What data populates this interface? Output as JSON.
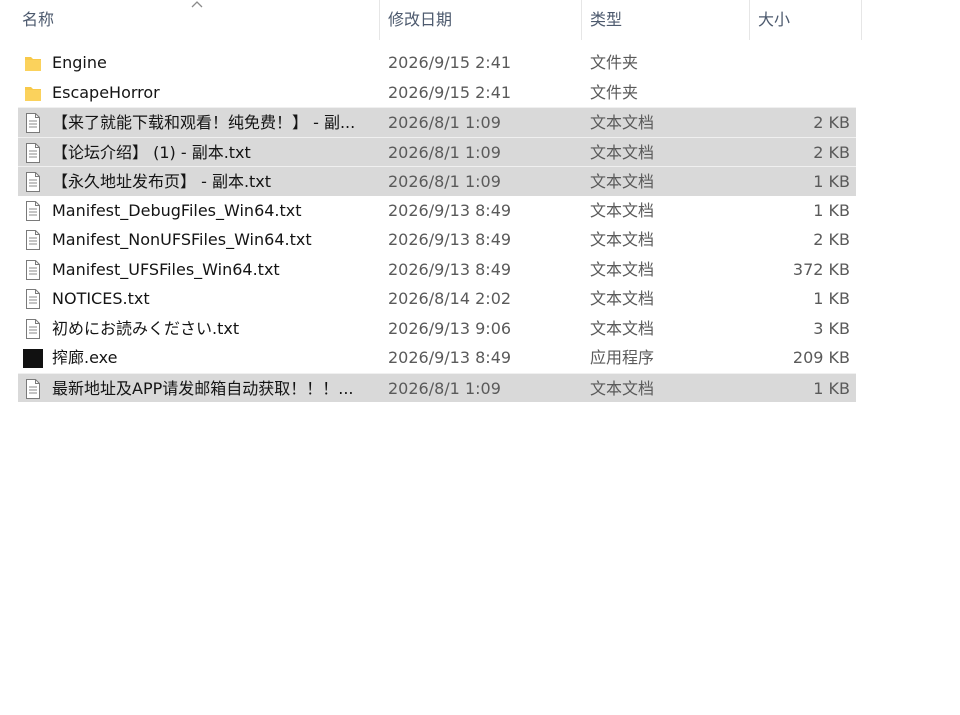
{
  "header": {
    "name": "名称",
    "date": "修改日期",
    "type": "类型",
    "size": "大小"
  },
  "files": [
    {
      "name": "Engine",
      "date": "2026/9/15 2:41",
      "type": "文件夹",
      "size": "",
      "icon": "folder-icon",
      "selected": false
    },
    {
      "name": "EscapeHorror",
      "date": "2026/9/15 2:41",
      "type": "文件夹",
      "size": "",
      "icon": "folder-icon",
      "selected": false
    },
    {
      "name": "【来了就能下载和观看！纯免费！】 - 副...",
      "date": "2026/8/1 1:09",
      "type": "文本文档",
      "size": "2 KB",
      "icon": "text-file-icon",
      "selected": true
    },
    {
      "name": "【论坛介绍】 (1) - 副本.txt",
      "date": "2026/8/1 1:09",
      "type": "文本文档",
      "size": "2 KB",
      "icon": "text-file-icon",
      "selected": true
    },
    {
      "name": "【永久地址发布页】 - 副本.txt",
      "date": "2026/8/1 1:09",
      "type": "文本文档",
      "size": "1 KB",
      "icon": "text-file-icon",
      "selected": true
    },
    {
      "name": "Manifest_DebugFiles_Win64.txt",
      "date": "2026/9/13 8:49",
      "type": "文本文档",
      "size": "1 KB",
      "icon": "text-file-icon",
      "selected": false
    },
    {
      "name": "Manifest_NonUFSFiles_Win64.txt",
      "date": "2026/9/13 8:49",
      "type": "文本文档",
      "size": "2 KB",
      "icon": "text-file-icon",
      "selected": false
    },
    {
      "name": "Manifest_UFSFiles_Win64.txt",
      "date": "2026/9/13 8:49",
      "type": "文本文档",
      "size": "372 KB",
      "icon": "text-file-icon",
      "selected": false
    },
    {
      "name": "NOTICES.txt",
      "date": "2026/8/14 2:02",
      "type": "文本文档",
      "size": "1 KB",
      "icon": "text-file-icon",
      "selected": false
    },
    {
      "name": "初めにお読みください.txt",
      "date": "2026/9/13 9:06",
      "type": "文本文档",
      "size": "3 KB",
      "icon": "text-file-icon",
      "selected": false
    },
    {
      "name": "搾廊.exe",
      "date": "2026/9/13 8:49",
      "type": "应用程序",
      "size": "209 KB",
      "icon": "exe-icon",
      "selected": false
    },
    {
      "name": "最新地址及APP请发邮箱自动获取！！！...",
      "date": "2026/8/1 1:09",
      "type": "文本文档",
      "size": "1 KB",
      "icon": "text-file-icon",
      "selected": true
    }
  ],
  "colors": {
    "selection": "#d9d9d9",
    "folder": "#f8c94a",
    "header_text": "#4d5a6e"
  }
}
